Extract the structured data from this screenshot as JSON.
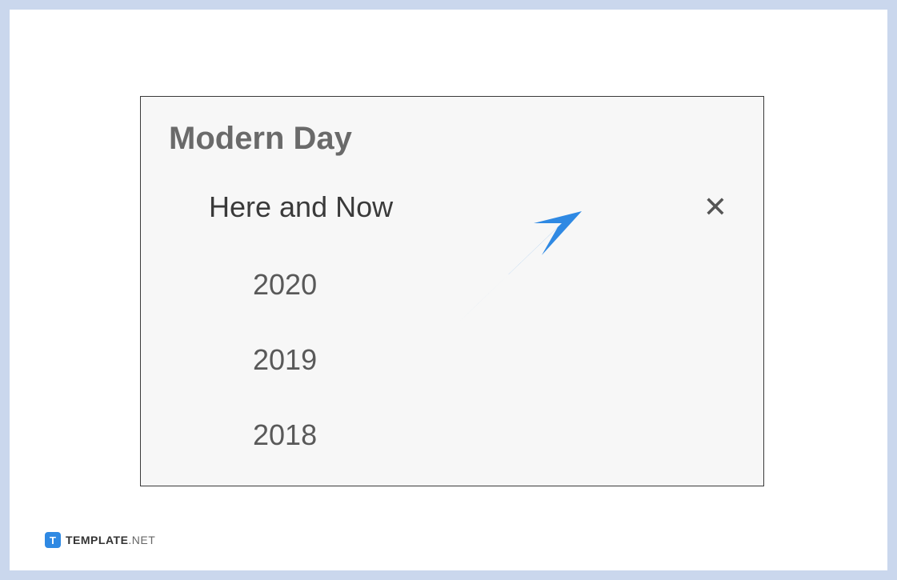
{
  "panel": {
    "title": "Modern Day",
    "selected_item": "Here and Now",
    "sub_items": [
      "2020",
      "2019",
      "2018"
    ]
  },
  "watermark": {
    "icon_letter": "T",
    "brand_bold": "TEMPLATE",
    "brand_light": ".NET"
  }
}
